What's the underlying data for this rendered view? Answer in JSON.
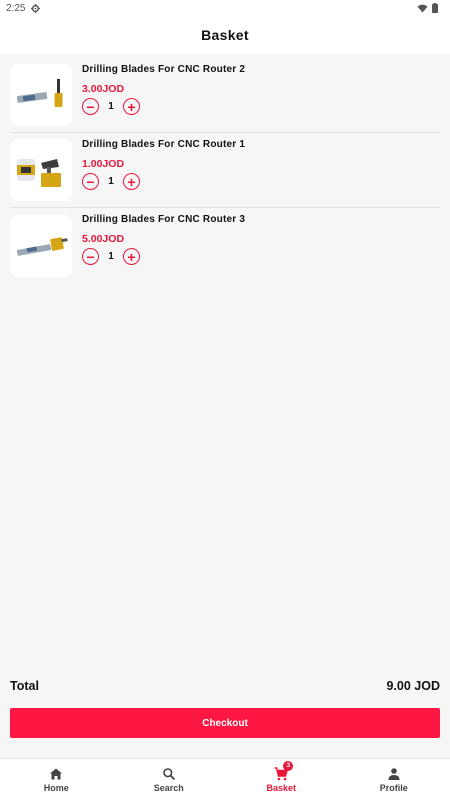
{
  "status_bar": {
    "time": "2:25"
  },
  "header": {
    "title": "Basket"
  },
  "basket": {
    "items": [
      {
        "name": "Drilling Blades For CNC Router 2",
        "price": "3.00JOD",
        "quantity": "1"
      },
      {
        "name": "Drilling Blades For CNC Router 1",
        "price": "1.00JOD",
        "quantity": "1"
      },
      {
        "name": "Drilling Blades For CNC Router 3",
        "price": "5.00JOD",
        "quantity": "1"
      }
    ],
    "total_label": "Total",
    "total_value": "9.00 JOD",
    "checkout_label": "Checkout"
  },
  "bottom_nav": {
    "items": [
      {
        "label": "Home",
        "icon": "home-icon"
      },
      {
        "label": "Search",
        "icon": "search-icon"
      },
      {
        "label": "Basket",
        "icon": "cart-icon",
        "badge": "3",
        "active": true
      },
      {
        "label": "Profile",
        "icon": "person-icon"
      }
    ]
  },
  "colors": {
    "accent": "#e8173a",
    "button": "#ff1744",
    "background": "#f6f6f6"
  }
}
